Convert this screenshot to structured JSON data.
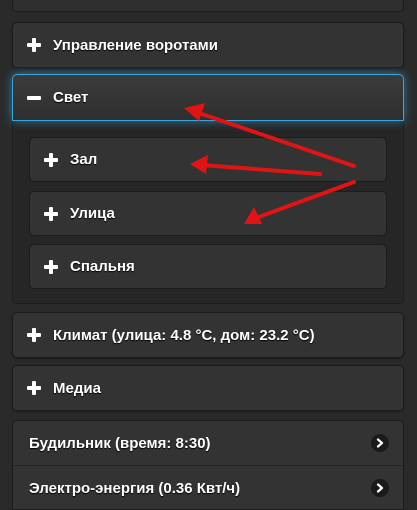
{
  "sections": {
    "gate": {
      "label": "Управление воротами",
      "icon": "plus-icon"
    },
    "light": {
      "label": "Свет",
      "icon": "minus-icon",
      "items": [
        {
          "label": "Зал"
        },
        {
          "label": "Улица"
        },
        {
          "label": "Спальня"
        }
      ]
    },
    "climate": {
      "label": "Климат (улица: 4.8 °C, дом: 23.2 °C)",
      "icon": "plus-icon"
    },
    "media": {
      "label": "Медиа",
      "icon": "plus-icon"
    }
  },
  "list": {
    "alarm": {
      "label": "Будильник (время: 8:30)",
      "icon": "chevron-right-icon"
    },
    "energy": {
      "label": "Электро-энергия (0.36 Квт/ч)",
      "icon": "chevron-right-icon"
    }
  },
  "colors": {
    "background": "#2a2a2a",
    "panel": "#333333",
    "active_border": "#3aa5d8",
    "annotation_arrow": "#e01414"
  }
}
